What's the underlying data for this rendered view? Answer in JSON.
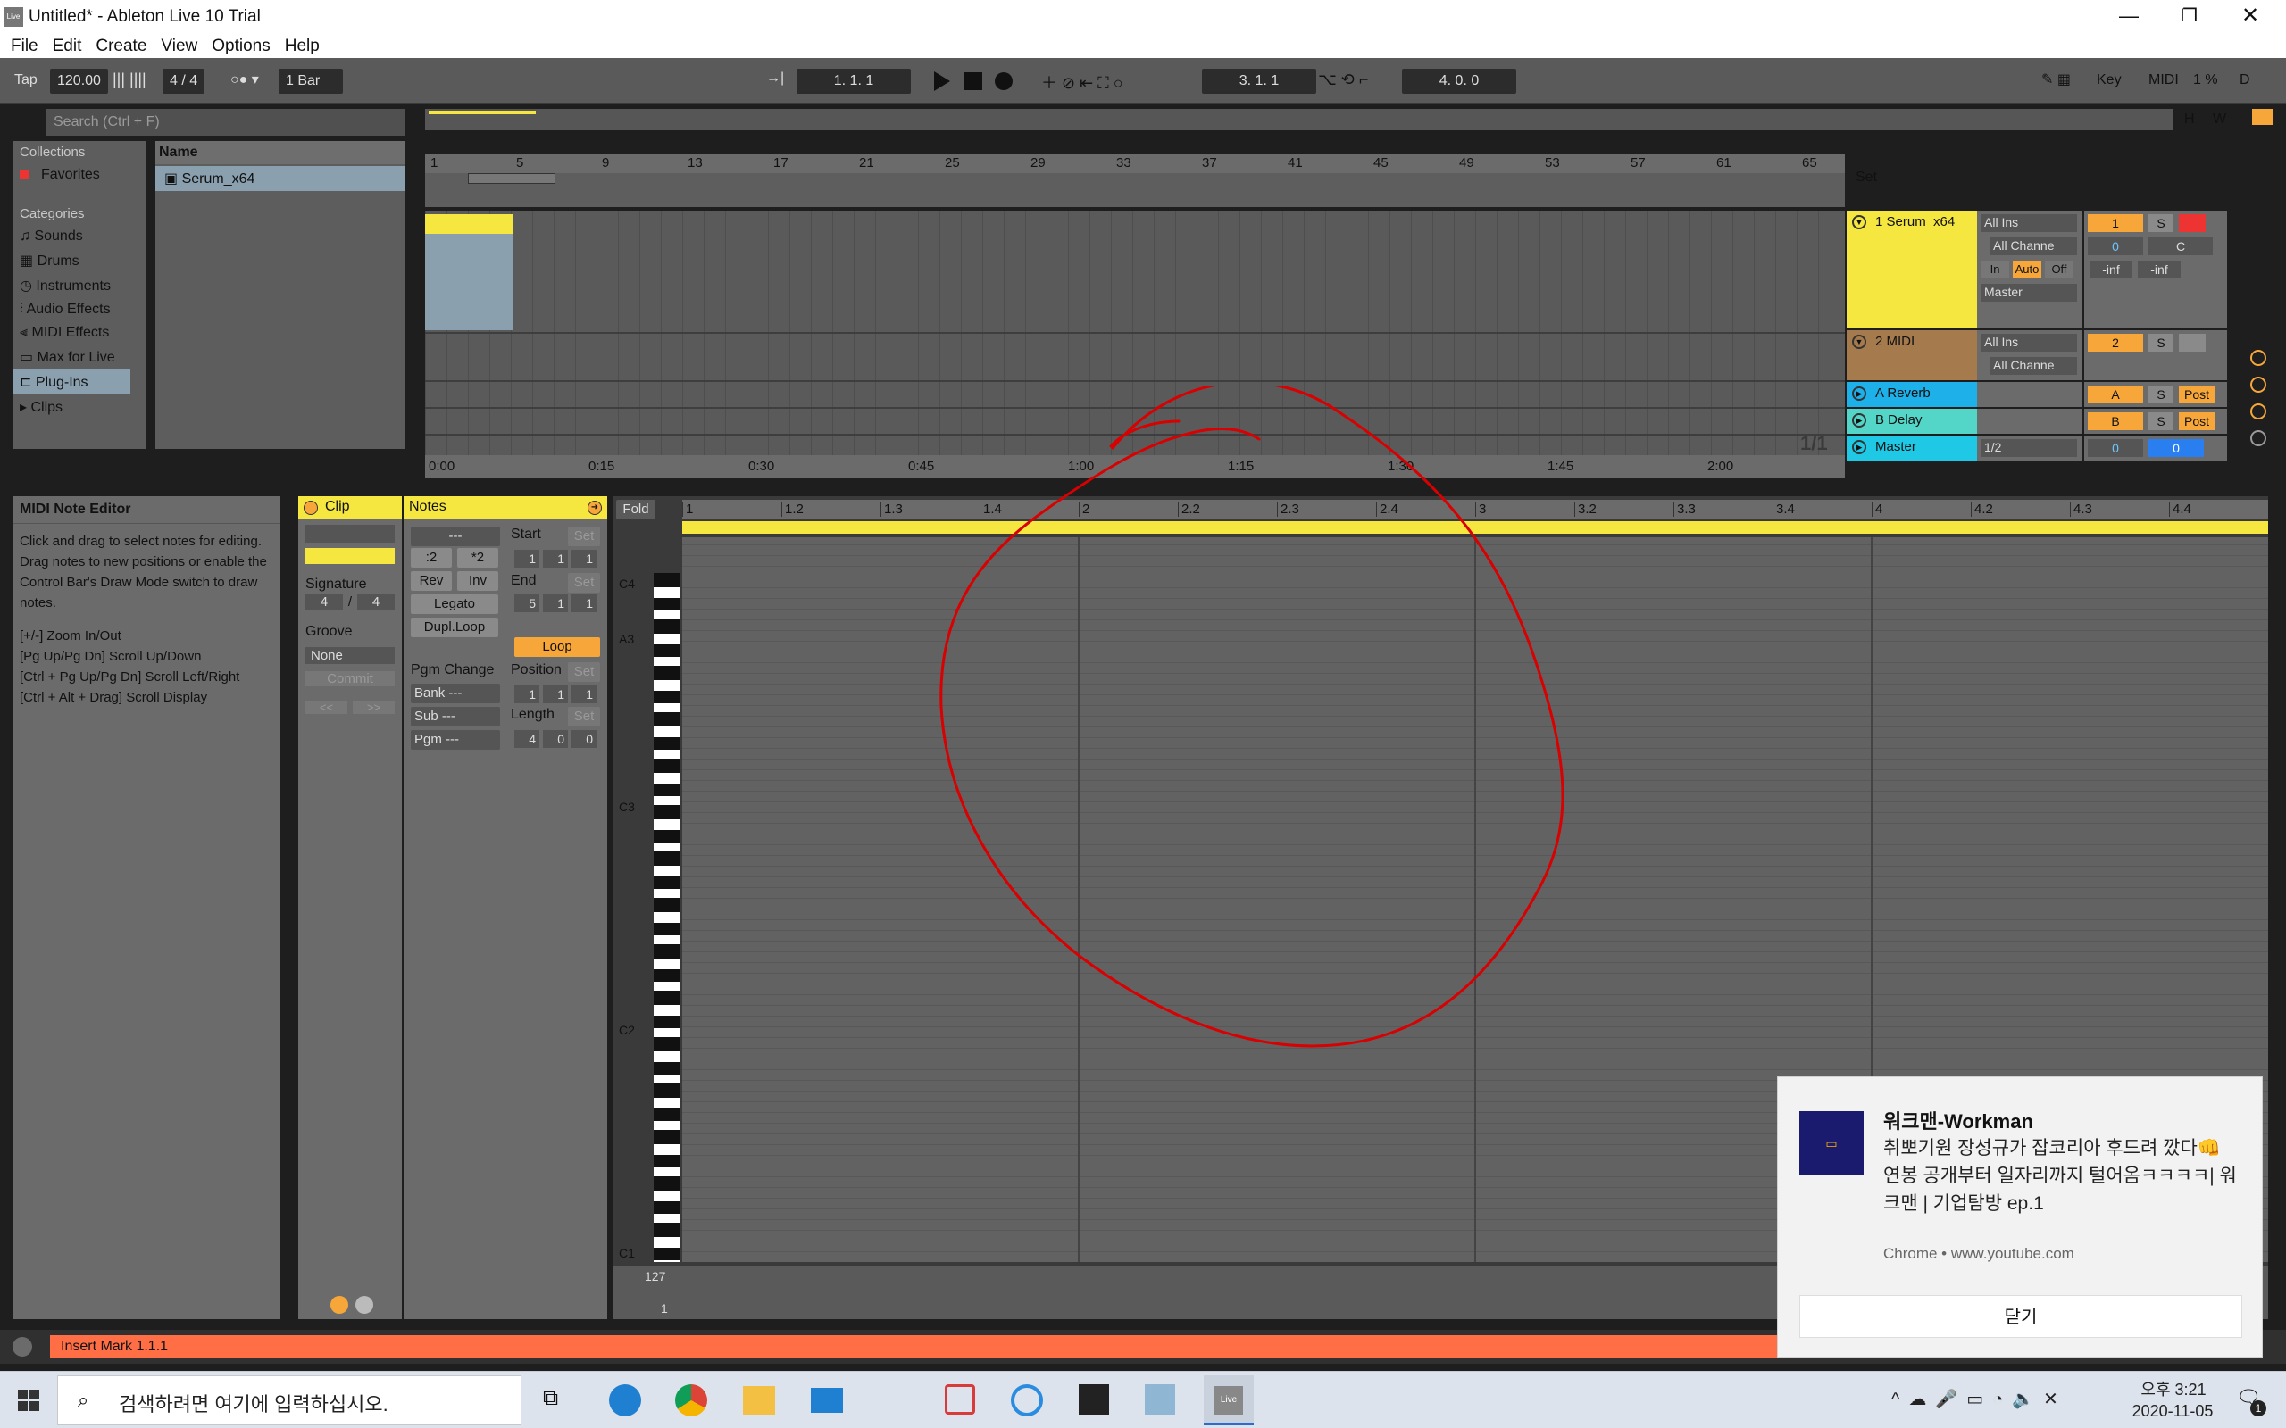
{
  "window": {
    "title": "Untitled* - Ableton Live 10 Trial",
    "app_badge": "Live"
  },
  "menu": [
    "File",
    "Edit",
    "Create",
    "View",
    "Options",
    "Help"
  ],
  "control_bar": {
    "tap": "Tap",
    "tempo": "120.00",
    "signature": "4 / 4",
    "quantize": "1 Bar",
    "position": "1.  1.  1",
    "loop_start": "3.  1.  1",
    "loop_length": "4.  0.  0",
    "key": "Key",
    "midi": "MIDI",
    "cpu": "1 %",
    "disk": "D"
  },
  "browser": {
    "search_placeholder": "Search (Ctrl + F)",
    "collections_header": "Collections",
    "favorites": "Favorites",
    "categories_header": "Categories",
    "categories": [
      "Sounds",
      "Drums",
      "Instruments",
      "Audio Effects",
      "MIDI Effects",
      "Max for Live",
      "Plug-Ins",
      "Clips"
    ],
    "name_header": "Name",
    "file": "Serum_x64"
  },
  "arrangement": {
    "bar_numbers": [
      "1",
      "5",
      "9",
      "13",
      "17",
      "21",
      "25",
      "29",
      "33",
      "37",
      "41",
      "45",
      "49",
      "53",
      "57",
      "61",
      "65"
    ],
    "time_labels": [
      "0:00",
      "0:15",
      "0:30",
      "0:45",
      "1:00",
      "1:15",
      "1:30",
      "1:45",
      "2:00"
    ],
    "set_label": "Set",
    "fraction": "1/1",
    "hw": [
      "H",
      "W"
    ]
  },
  "tracks": [
    {
      "name": "1 Serum_x64",
      "color": "#f5e640",
      "input": "All Ins",
      "channel": "All Channe",
      "monitor": [
        "In",
        "Auto",
        "Off"
      ],
      "output": "Master",
      "number": "1",
      "solo": "S",
      "vol": "0",
      "pan": "C",
      "peak1": "-inf",
      "peak2": "-inf"
    },
    {
      "name": "2 MIDI",
      "color": "#a57b4d",
      "input": "All Ins",
      "channel": "All Channe",
      "number": "2",
      "solo": "S"
    },
    {
      "name": "A Reverb",
      "color": "#1eb0e8",
      "number": "A",
      "solo": "S",
      "post": "Post"
    },
    {
      "name": "B Delay",
      "color": "#53d6c7",
      "number": "B",
      "solo": "S",
      "post": "Post"
    },
    {
      "name": "Master",
      "color": "#1fc9e6",
      "output": "1/2",
      "number": "0",
      "vol": "0"
    }
  ],
  "info": {
    "title": "MIDI Note Editor",
    "body": "Click and drag to select notes for editing. Drag notes to new positions or enable the Control Bar's Draw Mode switch to draw notes.",
    "shortcuts": [
      "[+/-] Zoom In/Out",
      "[Pg Up/Pg Dn] Scroll Up/Down",
      "[Ctrl + Pg Up/Pg Dn] Scroll Left/Right",
      "[Ctrl + Alt + Drag] Scroll Display"
    ]
  },
  "clip": {
    "header": "Clip",
    "signature_label": "Signature",
    "sig_num": "4",
    "sig_den": "4",
    "groove_label": "Groove",
    "groove_value": "None",
    "commit": "Commit"
  },
  "notes": {
    "header": "Notes",
    "dash": "---",
    "half": ":2",
    "double": "*2",
    "rev": "Rev",
    "inv": "Inv",
    "legato": "Legato",
    "dupl": "Dupl.Loop",
    "start_label": "Start",
    "end_label": "End",
    "set": "Set",
    "start": [
      "1",
      "1",
      "1"
    ],
    "end": [
      "5",
      "1",
      "1"
    ],
    "loop": "Loop",
    "pgm_change": "Pgm Change",
    "bank": "Bank ---",
    "sub": "Sub ---",
    "pgm": "Pgm ---",
    "position_label": "Position",
    "length_label": "Length",
    "position": [
      "1",
      "1",
      "1"
    ],
    "length": [
      "4",
      "0",
      "0"
    ]
  },
  "piano_roll": {
    "fold": "Fold",
    "ruler": [
      "1",
      "1.2",
      "1.3",
      "1.4",
      "2",
      "2.2",
      "2.3",
      "2.4",
      "3",
      "3.2",
      "3.3",
      "3.4",
      "4",
      "4.2",
      "4.3",
      "4.4"
    ],
    "keys": [
      "C4",
      "A3",
      "C3",
      "C2",
      "C1"
    ],
    "vel_top": "127",
    "vel_bottom": "1"
  },
  "status": {
    "text": "Insert Mark 1.1.1"
  },
  "toast": {
    "title": "워크맨-Workman",
    "body": "취뽀기원 장성규가 잡코리아 후드려 깠다👊 연봉 공개부터 일자리까지 털어옴ㅋㅋㅋㅋ| 워크맨 | 기업탐방 ep.1",
    "source": "Chrome • www.youtube.com",
    "close": "닫기"
  },
  "taskbar": {
    "search_placeholder": "검색하려면 여기에 입력하십시오.",
    "time": "오후 3:21",
    "date": "2020-11-05",
    "notif_count": "1"
  }
}
